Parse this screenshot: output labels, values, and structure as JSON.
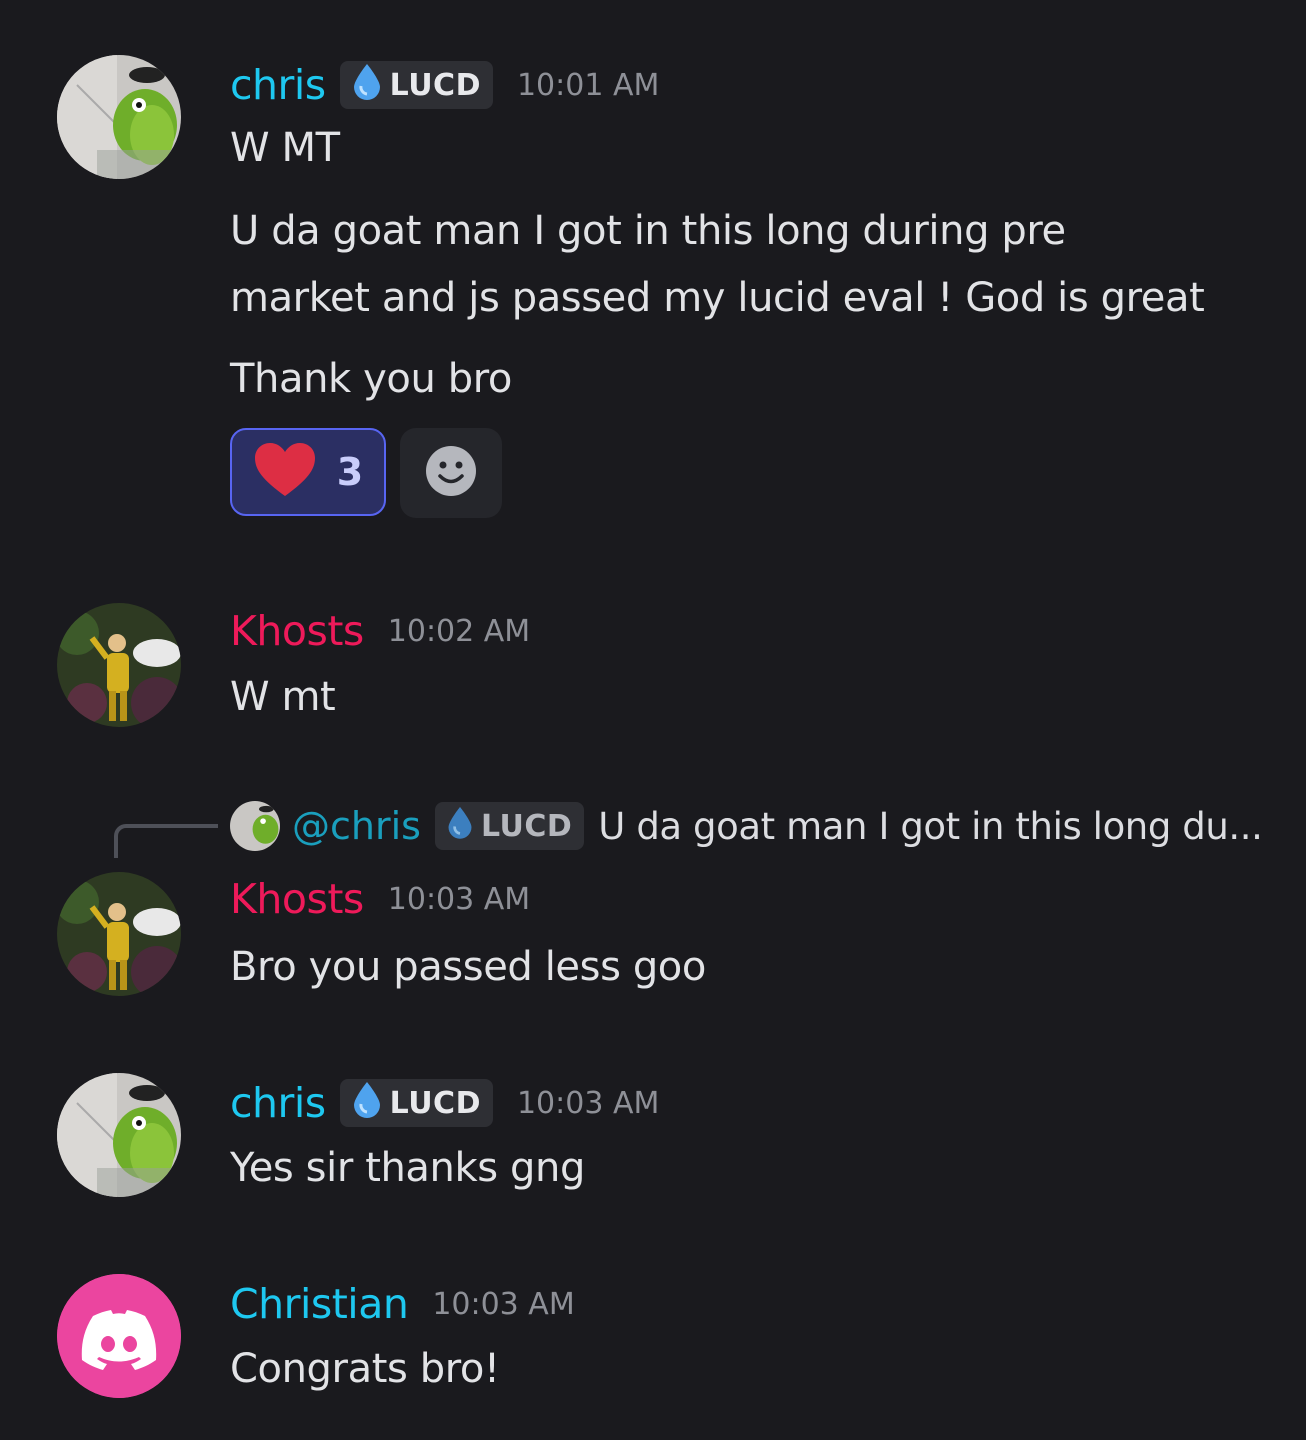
{
  "colors": {
    "background": "#1a1a1e",
    "chris": "#1ec8f0",
    "khosts": "#ee1a5a",
    "christian": "#1ec8f0",
    "reaction_bg": "#2b2f63",
    "reaction_border": "#5865f2",
    "discord_avatar": "#eb459f"
  },
  "messages": [
    {
      "author": "chris",
      "tag": "LUCD",
      "time": "10:01 AM",
      "lines": [
        "W MT",
        "U da goat man I got in this long during pre",
        "market and js passed my lucid eval ! God is great",
        "Thank you bro"
      ],
      "reactions": [
        {
          "emoji": "heart-icon",
          "count": "3"
        }
      ]
    },
    {
      "author": "Khosts",
      "time": "10:02 AM",
      "lines": [
        "W mt"
      ]
    },
    {
      "author": "Khosts",
      "time": "10:03 AM",
      "reply": {
        "mention": "@chris",
        "tag": "LUCD",
        "preview": "U da goat man I got in this long du..."
      },
      "lines": [
        "Bro you passed less goo"
      ]
    },
    {
      "author": "chris",
      "tag": "LUCD",
      "time": "10:03 AM",
      "lines": [
        "Yes sir thanks gng"
      ]
    },
    {
      "author": "Christian",
      "time": "10:03 AM",
      "lines": [
        "Congrats bro!"
      ]
    }
  ]
}
